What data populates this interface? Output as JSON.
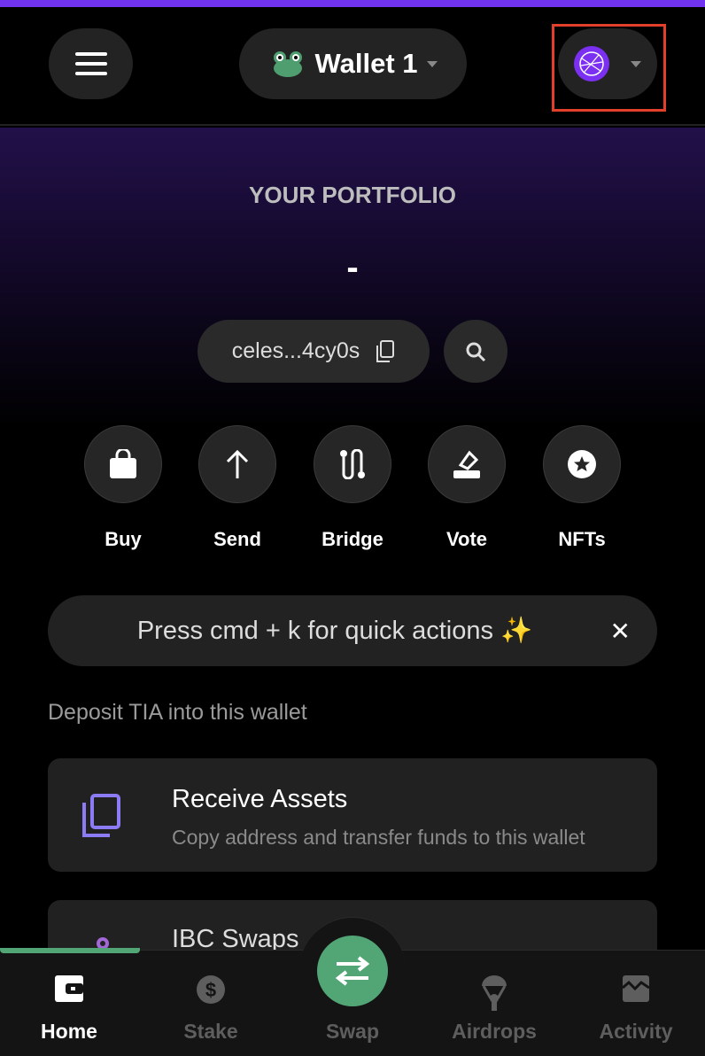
{
  "header": {
    "wallet_name": "Wallet 1",
    "menu_icon": "hamburger-icon",
    "wallet_icon": "frog-icon",
    "chain_icon": "celestia-icon"
  },
  "portfolio": {
    "title": "YOUR PORTFOLIO",
    "value": "-",
    "address": "celes...4cy0s"
  },
  "actions": [
    {
      "label": "Buy",
      "icon": "shopping-bag-icon"
    },
    {
      "label": "Send",
      "icon": "arrow-up-icon"
    },
    {
      "label": "Bridge",
      "icon": "bridge-icon"
    },
    {
      "label": "Vote",
      "icon": "vote-icon"
    },
    {
      "label": "NFTs",
      "icon": "star-icon"
    }
  ],
  "banner": {
    "text": "Press cmd + k for quick actions ✨"
  },
  "deposit": {
    "heading": "Deposit TIA into this wallet",
    "cards": [
      {
        "title": "Receive Assets",
        "subtitle": "Copy address and transfer funds to this wallet"
      },
      {
        "title": "IBC Swaps"
      }
    ]
  },
  "nav": {
    "items": [
      {
        "label": "Home",
        "active": true
      },
      {
        "label": "Stake"
      },
      {
        "label": "Swap"
      },
      {
        "label": "Airdrops"
      },
      {
        "label": "Activity"
      }
    ]
  },
  "colors": {
    "accent": "#7133f0",
    "green": "#52a676",
    "card": "#212121"
  }
}
